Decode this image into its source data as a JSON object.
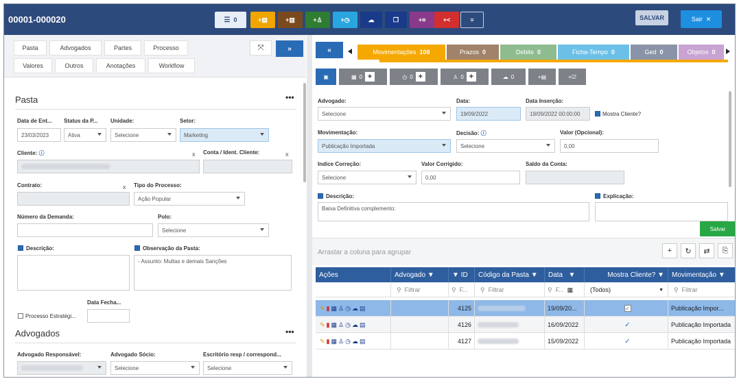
{
  "header": {
    "code": "00001-000020",
    "toolbar": [
      {
        "icon": "list-icon",
        "label": "0",
        "color": "#e8eef7",
        "fg": "#2d4a7c"
      },
      {
        "icon": "plus-calendar-icon",
        "label": "+",
        "color": "#f0a500",
        "fg": "#fff"
      },
      {
        "icon": "plus-document-icon",
        "label": "+",
        "color": "#7a4a1e",
        "fg": "#fff"
      },
      {
        "icon": "plus-person-icon",
        "label": "+",
        "color": "#2e7d32",
        "fg": "#fff"
      },
      {
        "icon": "plus-clock-icon",
        "label": "+",
        "color": "#29a6e0",
        "fg": "#fff"
      },
      {
        "icon": "cloud-upload-icon",
        "label": "",
        "color": "#1a3a8a",
        "fg": "#fff"
      },
      {
        "icon": "copy-icon",
        "label": "",
        "color": "#1a3a8a",
        "fg": "#fff"
      },
      {
        "icon": "plus-frame-icon",
        "label": "+",
        "color": "#8a3a8a",
        "fg": "#fff"
      },
      {
        "icon": "plus-share-icon",
        "label": "+",
        "color": "#d32f2f",
        "fg": "#fff"
      },
      {
        "icon": "menu-icon",
        "label": "",
        "color": "#2d4a7c",
        "fg": "#fff"
      }
    ],
    "save_label": "SALVAR",
    "exit_label": "Sair"
  },
  "left": {
    "tabs": [
      "Pasta",
      "Advogados",
      "Partes",
      "Processo",
      "Valores",
      "Outros",
      "Anotações",
      "Workflow"
    ],
    "pasta": {
      "title": "Pasta",
      "data_entrada_label": "Data de Ent...",
      "data_entrada_value": "23/03/2023",
      "status_label": "Status da P...",
      "status_value": "Ativa",
      "unidade_label": "Unidade:",
      "unidade_value": "Selecione",
      "setor_label": "Setor:",
      "setor_value": "Marketing",
      "cliente_label": "Cliente:",
      "conta_label": "Conta / Ident. Cliente:",
      "contrato_label": "Contrato:",
      "tipo_processo_label": "Tipo do Processo:",
      "tipo_processo_value": "Ação Popular",
      "numero_demanda_label": "Número da Demanda:",
      "polo_label": "Polo:",
      "polo_value": "Selecione",
      "descricao_label": "Descrição:",
      "observacao_label": "Observação da Pasta:",
      "observacao_value": "- Assunto: Multas e demais Sanções",
      "data_fecha_label": "Data Fecha...",
      "processo_estrategico_label": "Processo Estratégi..."
    },
    "advogados": {
      "title": "Advogados",
      "responsavel_label": "Advogado Responsável:",
      "socio_label": "Advogado Sócio:",
      "socio_value": "Selecione",
      "escritorio_label": "Escritório resp / correspond...",
      "escritorio_value": "Selecione"
    }
  },
  "right": {
    "tabs": [
      {
        "label": "Movimentações",
        "count": "108",
        "color": "#f5a800"
      },
      {
        "label": "Prazos",
        "count": "0",
        "color": "#a0836a"
      },
      {
        "label": "Debite",
        "count": "0",
        "color": "#8fbc8f"
      },
      {
        "label": "Ficha-Tempo",
        "count": "0",
        "color": "#6cc0e8"
      },
      {
        "label": "Ged",
        "count": "0",
        "color": "#8a94a8"
      },
      {
        "label": "Objetos",
        "count": "0",
        "color": "#c9a3d3"
      }
    ],
    "actions": [
      {
        "icon": "grid-icon",
        "count": ""
      },
      {
        "icon": "calendar-icon",
        "count": "0"
      },
      {
        "icon": "clock-icon",
        "count": "0"
      },
      {
        "icon": "person-icon",
        "count": "0"
      },
      {
        "icon": "cloud-icon",
        "count": "0"
      },
      {
        "icon": "plus-doc-icon",
        "count": "+"
      },
      {
        "icon": "plus-check-icon",
        "count": "+"
      }
    ],
    "form": {
      "advogado_label": "Advogado:",
      "advogado_value": "Selecione",
      "data_label": "Data:",
      "data_value": "19/09/2022",
      "data_insercao_label": "Data Inserção:",
      "data_insercao_value": "19/09/2022 00:00:00",
      "mostra_cliente_label": "Mostra Cliente?",
      "movimentacao_label": "Movimentação:",
      "movimentacao_value": "Publicação Importada",
      "decisao_label": "Decisão:",
      "decisao_value": "Selecione",
      "valor_label": "Valor (Opcional):",
      "valor_value": "0,00",
      "indice_label": "Indice Correção:",
      "indice_value": "Selecione",
      "valor_corrigido_label": "Valor Corrigido:",
      "valor_corrigido_value": "0,00",
      "saldo_label": "Saldo da Conta:",
      "descricao_label": "Descrição:",
      "descricao_value": "Baixa Definitiva complemento:",
      "explicacao_label": "Explicação:",
      "salvar_label": "Salvar"
    },
    "grid": {
      "group_hint": "Arrastar a coluna para agrupar",
      "columns": [
        "Ações",
        "Advogado",
        "ID",
        "Código da Pasta",
        "Data",
        "Mostra Cliente?",
        "Movimentação"
      ],
      "filter_placeholder": "Filtrar",
      "filter_short": "F...",
      "todos": "(Todos)",
      "rows": [
        {
          "id": "4125",
          "data": "19/09/20...",
          "mov": "Publicação Impor...",
          "selected": true
        },
        {
          "id": "4126",
          "data": "16/09/2022",
          "mov": "Publicação Importada",
          "selected": false
        },
        {
          "id": "4127",
          "data": "15/09/2022",
          "mov": "Publicação Importada",
          "selected": false
        }
      ]
    }
  }
}
